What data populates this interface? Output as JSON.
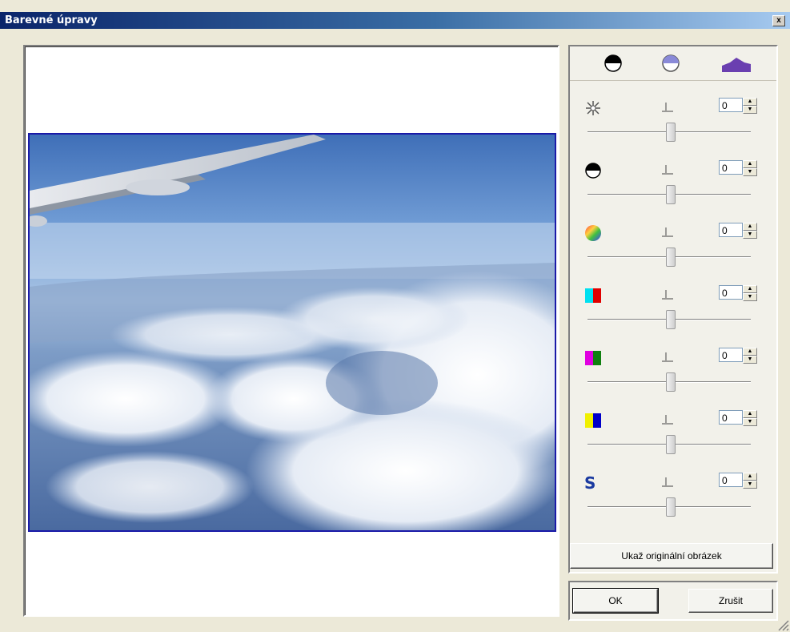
{
  "window": {
    "title": "Barevné úpravy",
    "close_symbol": "x"
  },
  "preview": {
    "image": "airplane-wing-over-clouds-photo"
  },
  "tabs": [
    {
      "icon": "contrast-icon"
    },
    {
      "icon": "brightness-icon"
    },
    {
      "icon": "histogram-icon"
    }
  ],
  "adjustments": [
    {
      "icon": "sparkle-icon",
      "value": "0",
      "level": 0
    },
    {
      "icon": "contrast-icon",
      "value": "0",
      "level": 0
    },
    {
      "icon": "color-wheel-icon",
      "value": "0",
      "level": 0
    },
    {
      "icon": "cyan-red-icon",
      "value": "0",
      "level": 0
    },
    {
      "icon": "magenta-green-icon",
      "value": "0",
      "level": 0
    },
    {
      "icon": "yellow-blue-icon",
      "value": "0",
      "level": 0
    },
    {
      "icon": "saturation-s-icon",
      "value": "0",
      "level": 0,
      "glyph": "S"
    }
  ],
  "buttons": {
    "show_original": "Ukaž originální obrázek",
    "ok": "OK",
    "cancel": "Zrušit"
  },
  "colors": {
    "title_start": "#0a246a",
    "title_end": "#a6caf0",
    "photo_border": "#1a1aa8"
  }
}
